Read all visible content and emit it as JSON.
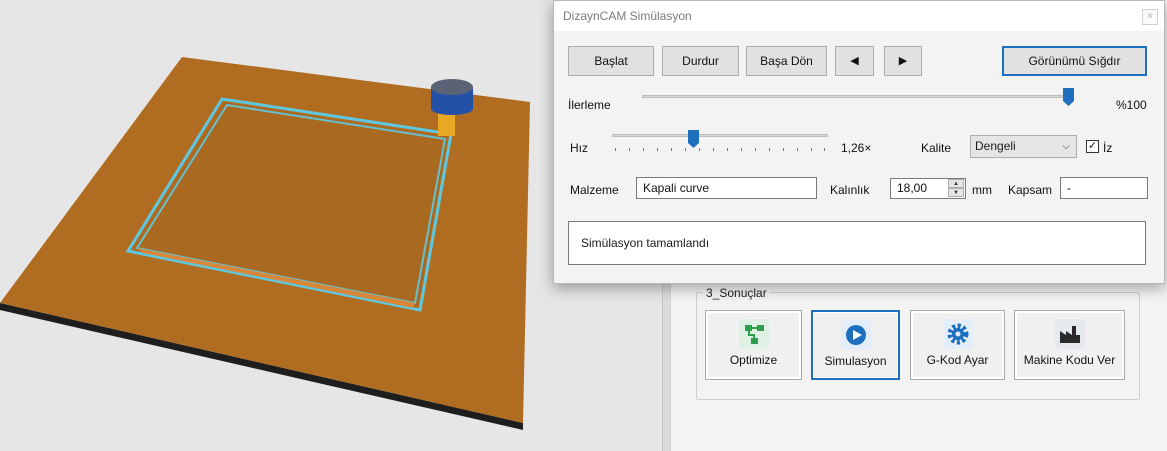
{
  "dialog": {
    "title": "DizaynCAM Simülasyon",
    "close_glyph": "×",
    "buttons": {
      "start": "Başlat",
      "stop": "Durdur",
      "rewind": "Başa Dön",
      "prev": "◀",
      "next": "▶",
      "fit_view": "Görünümü Sığdır"
    },
    "progress": {
      "label": "İlerleme",
      "value_text": "%100",
      "fraction": 1.0
    },
    "speed": {
      "label": "Hız",
      "value_text": "1,26×",
      "fraction": 0.37
    },
    "quality": {
      "label": "Kalite",
      "selected": "Dengeli",
      "chevron": "⌵"
    },
    "trail": {
      "checked": true,
      "check_glyph": "✓",
      "label": "İz"
    },
    "material": {
      "label": "Malzeme",
      "value": "Kapali curve"
    },
    "thickness": {
      "label": "Kalınlık",
      "value": "18,00",
      "unit": "mm",
      "up": "▲",
      "down": "▼"
    },
    "coverage": {
      "label": "Kapsam",
      "value": "-"
    },
    "status": "Simülasyon tamamlandı"
  },
  "results": {
    "group_label": "3_Sonuçlar",
    "buttons": [
      {
        "label": "Optimize",
        "icon": "flow-icon",
        "color": "#2e9e4f"
      },
      {
        "label": "Simulasyon",
        "icon": "play-icon",
        "color": "#1f6fbf"
      },
      {
        "label": "G-Kod Ayar",
        "icon": "gear-icon",
        "color": "#1f6fbf"
      },
      {
        "label": "Makine Kodu Ver",
        "icon": "factory-icon",
        "color": "#2b2b2b"
      }
    ]
  },
  "colors": {
    "board": "#b06d22",
    "board_edge": "#1e1e1e",
    "toolpath": "#5ec8e0",
    "tool_head": "#2451a8",
    "tool_shank": "#e8a823",
    "accent": "#1f6fbf"
  }
}
